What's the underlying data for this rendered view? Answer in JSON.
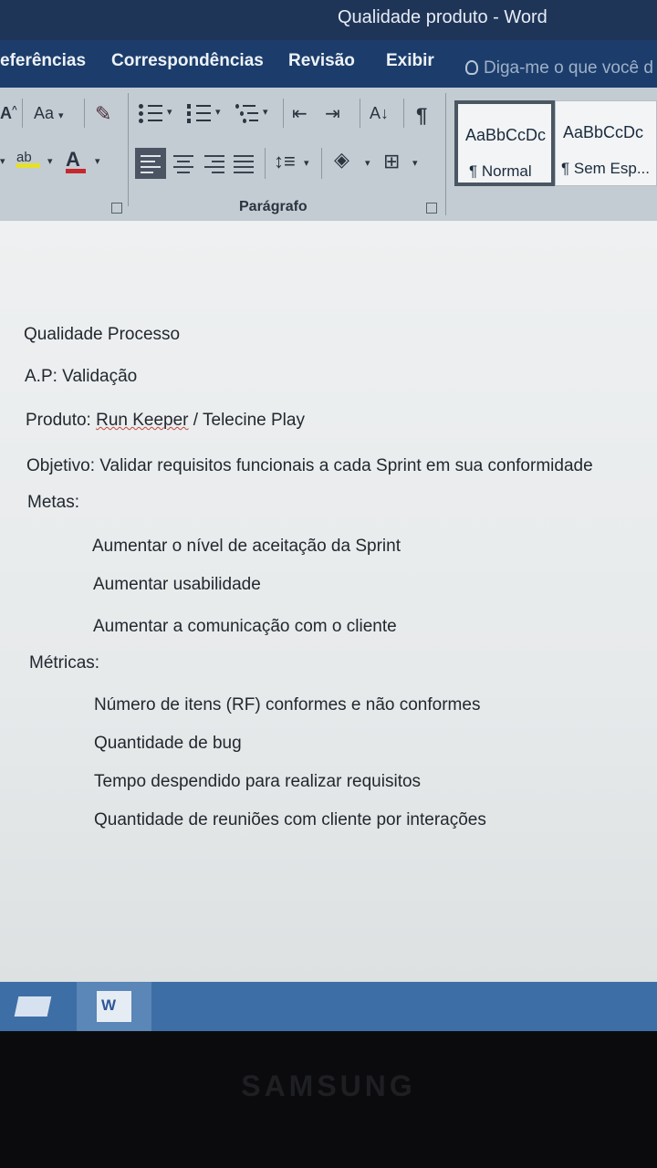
{
  "window": {
    "title": "Qualidade produto - Word"
  },
  "tabs": [
    {
      "label": "eferências"
    },
    {
      "label": "Correspondências"
    },
    {
      "label": "Revisão"
    },
    {
      "label": "Exibir"
    }
  ],
  "tell_me": {
    "placeholder": "Diga-me o que você d"
  },
  "ribbon": {
    "font_case_label": "Aa",
    "highlight_label": "ab",
    "font_color_label": "A",
    "sort_label": "A↓",
    "pilcrow_label": "¶",
    "paragraph_group_label": "Parágrafo",
    "styles": [
      {
        "sample": "AaBbCcDc",
        "name": "¶ Normal",
        "selected": true
      },
      {
        "sample": "AaBbCcDc",
        "name": "¶ Sem Esp...",
        "selected": false
      }
    ]
  },
  "document": {
    "heading": "Qualidade Processo",
    "ap": "A.P:  Validação",
    "product_prefix": "Produto: ",
    "product_name": "Run Keeper",
    "product_suffix": " / Telecine Play",
    "objective": "Objetivo: Validar requisitos funcionais a cada Sprint em sua conformidade",
    "metas_label": "Metas:",
    "metas": [
      "Aumentar o nível de aceitação da Sprint",
      "Aumentar usabilidade",
      "Aumentar a comunicação com o cliente"
    ],
    "metricas_label": "Métricas:",
    "metricas": [
      "Número de itens (RF) conformes e não conformes",
      "Quantidade de bug",
      "Tempo despendido para realizar requisitos",
      "Quantidade de reuniões com cliente por interações"
    ]
  },
  "taskbar": {
    "word_icon_letter": "W"
  },
  "bezel": {
    "brand": "SAMSUNG"
  },
  "colors": {
    "titlebar": "#1f3558",
    "tabs": "#1c3d6b",
    "taskbar": "#3e6ea6",
    "misspelling": "#c4473e"
  }
}
